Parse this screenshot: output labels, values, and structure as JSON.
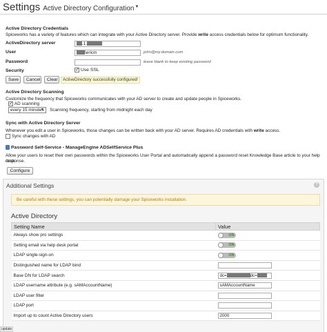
{
  "header": {
    "title": "Settings",
    "subtitle": "Active Directory Configuration"
  },
  "credentials": {
    "heading": "Active Directory Credentials",
    "intro_pre": "Spiceworks has a variety of features which can integrate with your Active Directory server. Provide ",
    "intro_bold": "write",
    "intro_post": " access credentials below for optimum functionality.",
    "server_label": "ActiveDirectory server",
    "server_value": ".1.",
    "user_label": "User",
    "user_value": "\\ericm",
    "user_hint": "john@my.domain.com",
    "password_label": "Password",
    "password_hint": "leave blank to keep existing password",
    "security_label": "Security",
    "use_ssl_label": "Use SSL",
    "save_label": "Save",
    "cancel_label": "Cancel",
    "clear_label": "Clear",
    "success_message": "ActiveDirectory successfully configured!"
  },
  "scanning": {
    "heading": "Active Directory Scanning",
    "intro": "Customize the frequency that Spiceworks communicates with your AD server to create and update people in Spiceworks.",
    "ad_scanning_label": "AD scanning",
    "frequency_value": "every 15 minutes",
    "frequency_hint": "Scanning frequency, starting from midnight each day"
  },
  "sync": {
    "heading": "Sync with Active Directory Server",
    "intro_pre": "Whenever you edit a user in Spiceworks, those changes can be written back with your AD server. Requires AD credentials with ",
    "intro_bold": "write",
    "intro_post": " access.",
    "sync_label": "Sync changes with AD"
  },
  "self_service": {
    "heading": "Password Self-Service - ManageEngine ADSelfService Plus",
    "intro_line1": "Allow your users to reset their own passwords within the Spiceworks User Portal and automatically append a password reset Knowledge Base article to your help desk",
    "intro_line2": "response.",
    "configure_label": "Configure"
  },
  "additional": {
    "heading": "Additional Settings",
    "help_label": "?",
    "warning": "Be careful with these settings, you can potentially damage your Spiceworks installation.",
    "ad_title": "Active Directory",
    "col_setting": "Setting Name",
    "col_value": "Value",
    "toggle_on": "ON",
    "rows": [
      {
        "name": "Always show pro settings"
      },
      {
        "name": "Setting email via help desk portal"
      },
      {
        "name": "LDAP single-sign-on"
      },
      {
        "name": "Distinguished name for LDAP bind",
        "value": ""
      },
      {
        "name": "Base DN for LDAP search",
        "value_a": "dc=",
        "value_b": "dc="
      },
      {
        "name": "LDAP username attribute (e.g. sAMAccountName)",
        "value": "sAMAccountName"
      },
      {
        "name": "LDAP user filter",
        "value": ""
      },
      {
        "name": "LDAP port",
        "value": ""
      },
      {
        "name": "Import up to count Active Directory users",
        "value": "2000"
      }
    ]
  },
  "corner_label": "update"
}
